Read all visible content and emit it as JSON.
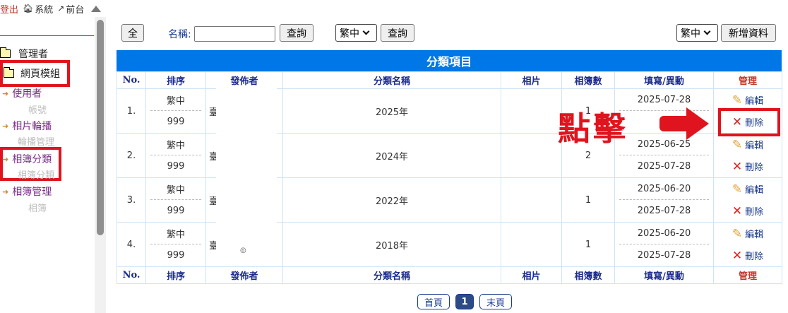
{
  "topbar": {
    "logout": "登出",
    "system": "系統",
    "frontend": "前台"
  },
  "sidebar": {
    "admin": "管理者",
    "web_module": "網頁模組",
    "items": [
      {
        "label": "使用者",
        "sub": "帳號"
      },
      {
        "label": "相片輪播",
        "sub": "輪播管理"
      },
      {
        "label": "相簿分類",
        "sub": "相簿分類"
      },
      {
        "label": "相簿管理",
        "sub": "相簿"
      }
    ]
  },
  "toolbar": {
    "all_label": "全",
    "name_label": "名稱:",
    "name_value": "",
    "lang_select": "繁中",
    "search_label": "查詢",
    "search_label2": "查詢",
    "lang_select_right": "繁中",
    "add_label": "新增資料"
  },
  "table": {
    "caption": "分類項目",
    "headers": [
      "No.",
      "排序",
      "發佈者",
      "分類名稱",
      "相片",
      "相簿數",
      "填寫/異動",
      "管理"
    ],
    "rows": [
      {
        "no": "1.",
        "lang": "繁中",
        "sort": "999",
        "publisher": "臺",
        "name": "2025年",
        "photos": "",
        "albums": "1",
        "created": "2025-07-28",
        "modified": ""
      },
      {
        "no": "2.",
        "lang": "繁中",
        "sort": "999",
        "publisher": "臺",
        "name": "2024年",
        "photos": "",
        "albums": "2",
        "created": "2025-06-25",
        "modified": "2025-07-28"
      },
      {
        "no": "3.",
        "lang": "繁中",
        "sort": "999",
        "publisher": "臺",
        "name": "2022年",
        "photos": "",
        "albums": "1",
        "created": "2025-06-20",
        "modified": "2025-07-28"
      },
      {
        "no": "4.",
        "lang": "繁中",
        "sort": "999",
        "publisher": "臺",
        "name": "2018年",
        "photos": "",
        "albums": "1",
        "created": "2025-06-20",
        "modified": "2025-07-28"
      }
    ],
    "edit_label": "編輯",
    "delete_label": "刪除",
    "publisher_suffix_row4": "◎"
  },
  "annotation": {
    "text": "點擊"
  },
  "pagination": {
    "first": "首頁",
    "current": "1",
    "last": "末頁"
  },
  "colors": {
    "caption_bg": "#0077e6",
    "annotation_red": "#e0141e"
  }
}
